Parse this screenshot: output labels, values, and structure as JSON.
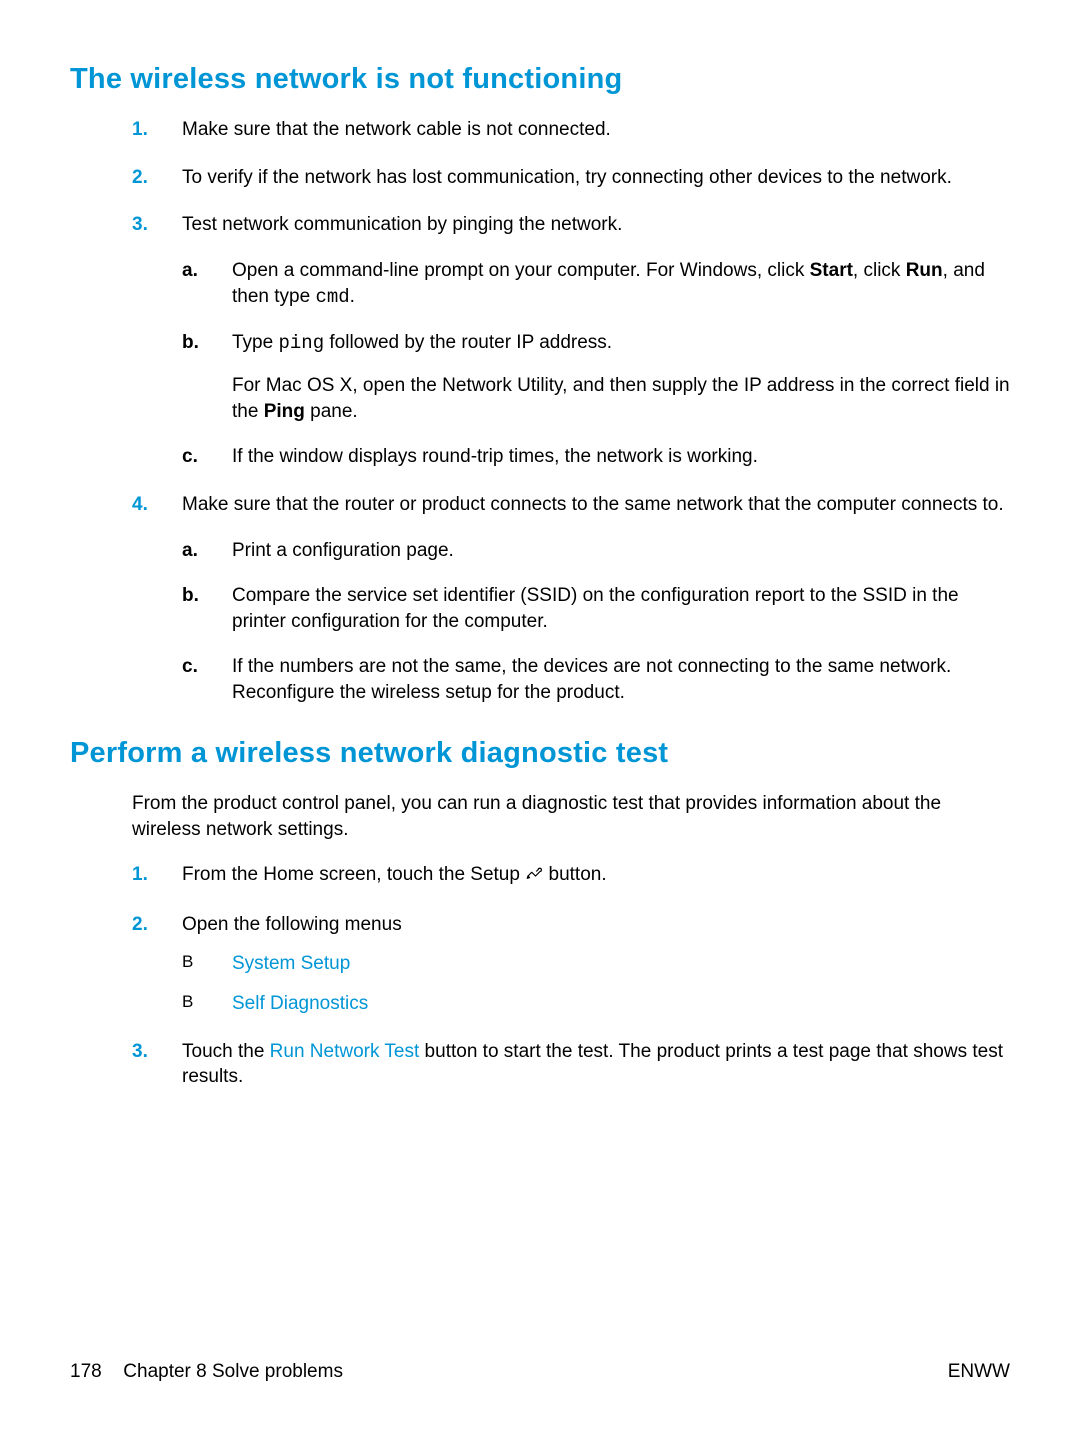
{
  "section1": {
    "title": "The wireless network is not functioning",
    "items": [
      {
        "marker": "1.",
        "text": "Make sure that the network cable is not connected."
      },
      {
        "marker": "2.",
        "text": "To verify if the network has lost communication, try connecting other devices to the network."
      },
      {
        "marker": "3.",
        "text": "Test network communication by pinging the network.",
        "sub": [
          {
            "marker": "a.",
            "frag_a1": "Open a command-line prompt on your computer. For Windows, click ",
            "frag_start": "Start",
            "frag_a2": ", click ",
            "frag_run": "Run",
            "frag_a3": ", and then type ",
            "frag_cmd": "cmd",
            "frag_a4": "."
          },
          {
            "marker": "b.",
            "frag_b1": "Type ",
            "frag_ping": "ping",
            "frag_b2": " followed by the router IP address.",
            "para_b1": "For Mac OS X, open the Network Utility, and then supply the IP address in the correct field in the ",
            "para_b_ping": "Ping",
            "para_b2": " pane."
          },
          {
            "marker": "c.",
            "text": "If the window displays round-trip times, the network is working."
          }
        ]
      },
      {
        "marker": "4.",
        "text": "Make sure that the router or product connects to the same network that the computer connects to.",
        "sub": [
          {
            "marker": "a.",
            "text": "Print a configuration page."
          },
          {
            "marker": "b.",
            "text": "Compare the service set identifier (SSID) on the configuration report to the SSID in the printer configuration for the computer."
          },
          {
            "marker": "c.",
            "text": "If the numbers are not the same, the devices are not connecting to the same network. Reconfigure the wireless setup for the product."
          }
        ]
      }
    ]
  },
  "section2": {
    "title": "Perform a wireless network diagnostic test",
    "intro": "From the product control panel, you can run a diagnostic test that provides information about the wireless network settings.",
    "items": [
      {
        "marker": "1.",
        "frag1": "From the Home screen, touch the Setup ",
        "frag2": " button."
      },
      {
        "marker": "2.",
        "text": "Open the following menus",
        "menus": [
          {
            "bullet": "B",
            "label": "System Setup"
          },
          {
            "bullet": "B",
            "label": "Self Diagnostics"
          }
        ]
      },
      {
        "marker": "3.",
        "frag1": "Touch the ",
        "menu": "Run Network Test",
        "frag2": " button to start the test. The product prints a test page that shows test results."
      }
    ]
  },
  "footer": {
    "page_number": "178",
    "chapter": "Chapter 8   Solve problems",
    "right": "ENWW"
  }
}
